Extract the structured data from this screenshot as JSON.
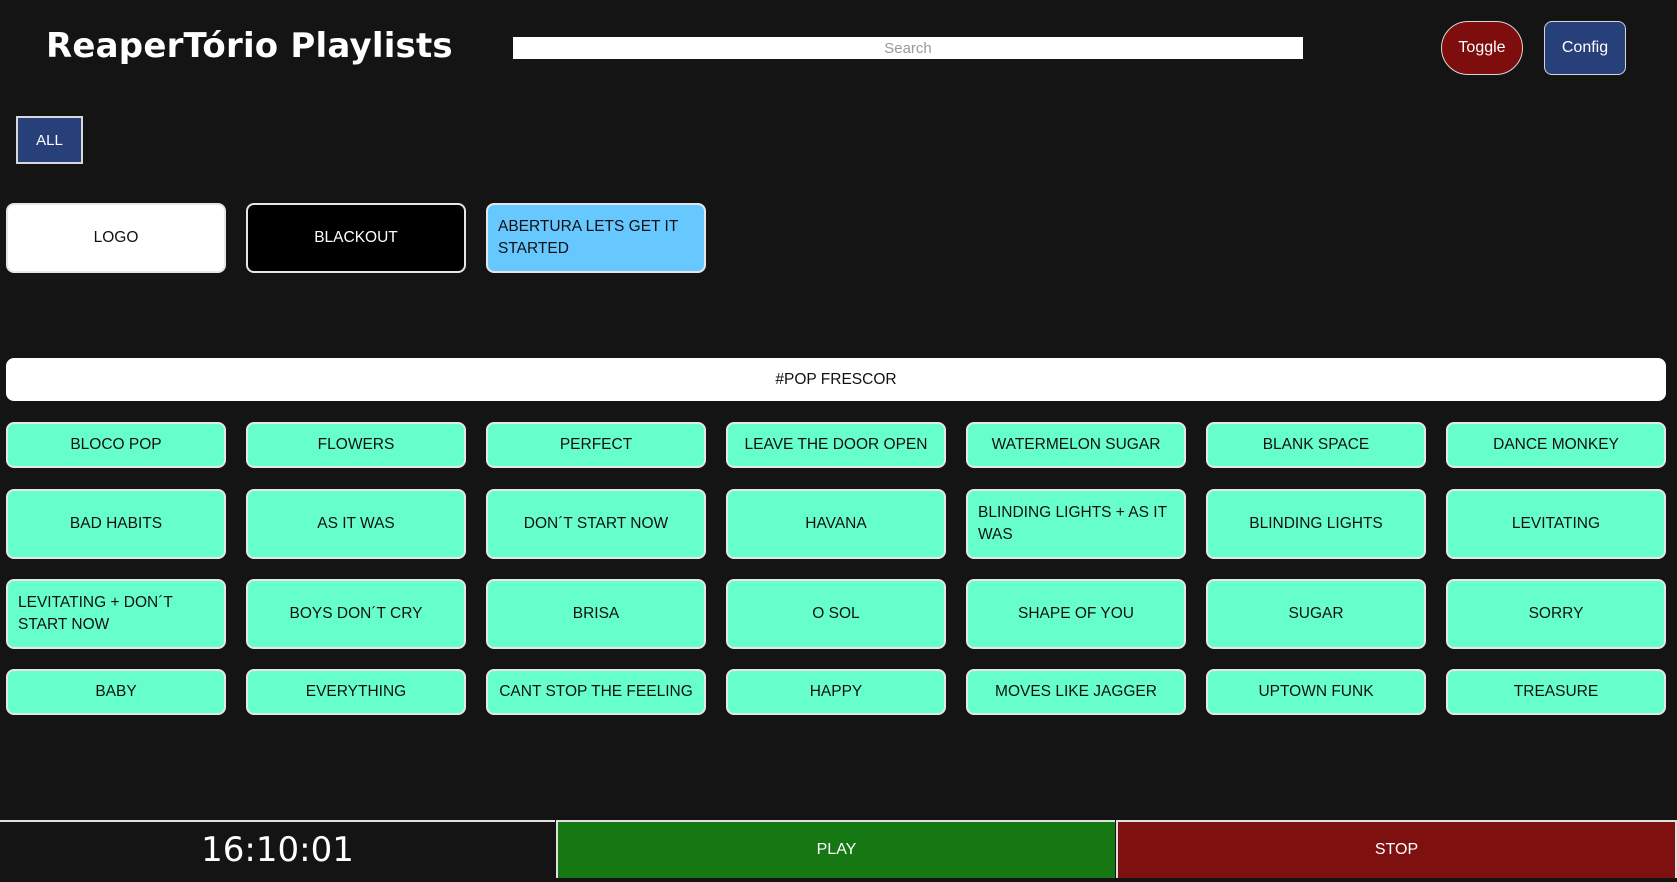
{
  "header": {
    "title": "ReaperTório Playlists",
    "search_placeholder": "Search",
    "toggle_label": "Toggle",
    "config_label": "Config"
  },
  "filters": {
    "all_label": "ALL"
  },
  "quick": {
    "logo": "LOGO",
    "blackout": "BLACKOUT",
    "abertura": "ABERTURA LETS GET IT STARTED"
  },
  "section": {
    "title": "#POP FRESCOR"
  },
  "songs": [
    "BLOCO POP",
    "FLOWERS",
    "PERFECT",
    "LEAVE THE DOOR OPEN",
    "WATERMELON SUGAR",
    "BLANK SPACE",
    "DANCE MONKEY",
    "BAD HABITS",
    "AS IT WAS",
    "DON´T START NOW",
    "HAVANA",
    "BLINDING LIGHTS + AS IT WAS",
    "BLINDING LIGHTS",
    "LEVITATING",
    "LEVITATING + DON´T START NOW",
    "BOYS DON´T CRY",
    "BRISA",
    "O SOL",
    "SHAPE OF YOU",
    "SUGAR",
    "SORRY",
    "BABY",
    "EVERYTHING",
    "CANT STOP THE FEELING",
    "HAPPY",
    "MOVES LIKE JAGGER",
    "UPTOWN FUNK",
    "TREASURE"
  ],
  "footer": {
    "clock": "16:10:01",
    "play_label": "PLAY",
    "stop_label": "STOP"
  },
  "colors": {
    "background": "#141414",
    "song_tile": "#66ffcc",
    "abertura_tile": "#66c8ff",
    "toggle": "#7e0d0d",
    "config": "#27407a",
    "play": "#157812",
    "stop": "#7e1010"
  }
}
